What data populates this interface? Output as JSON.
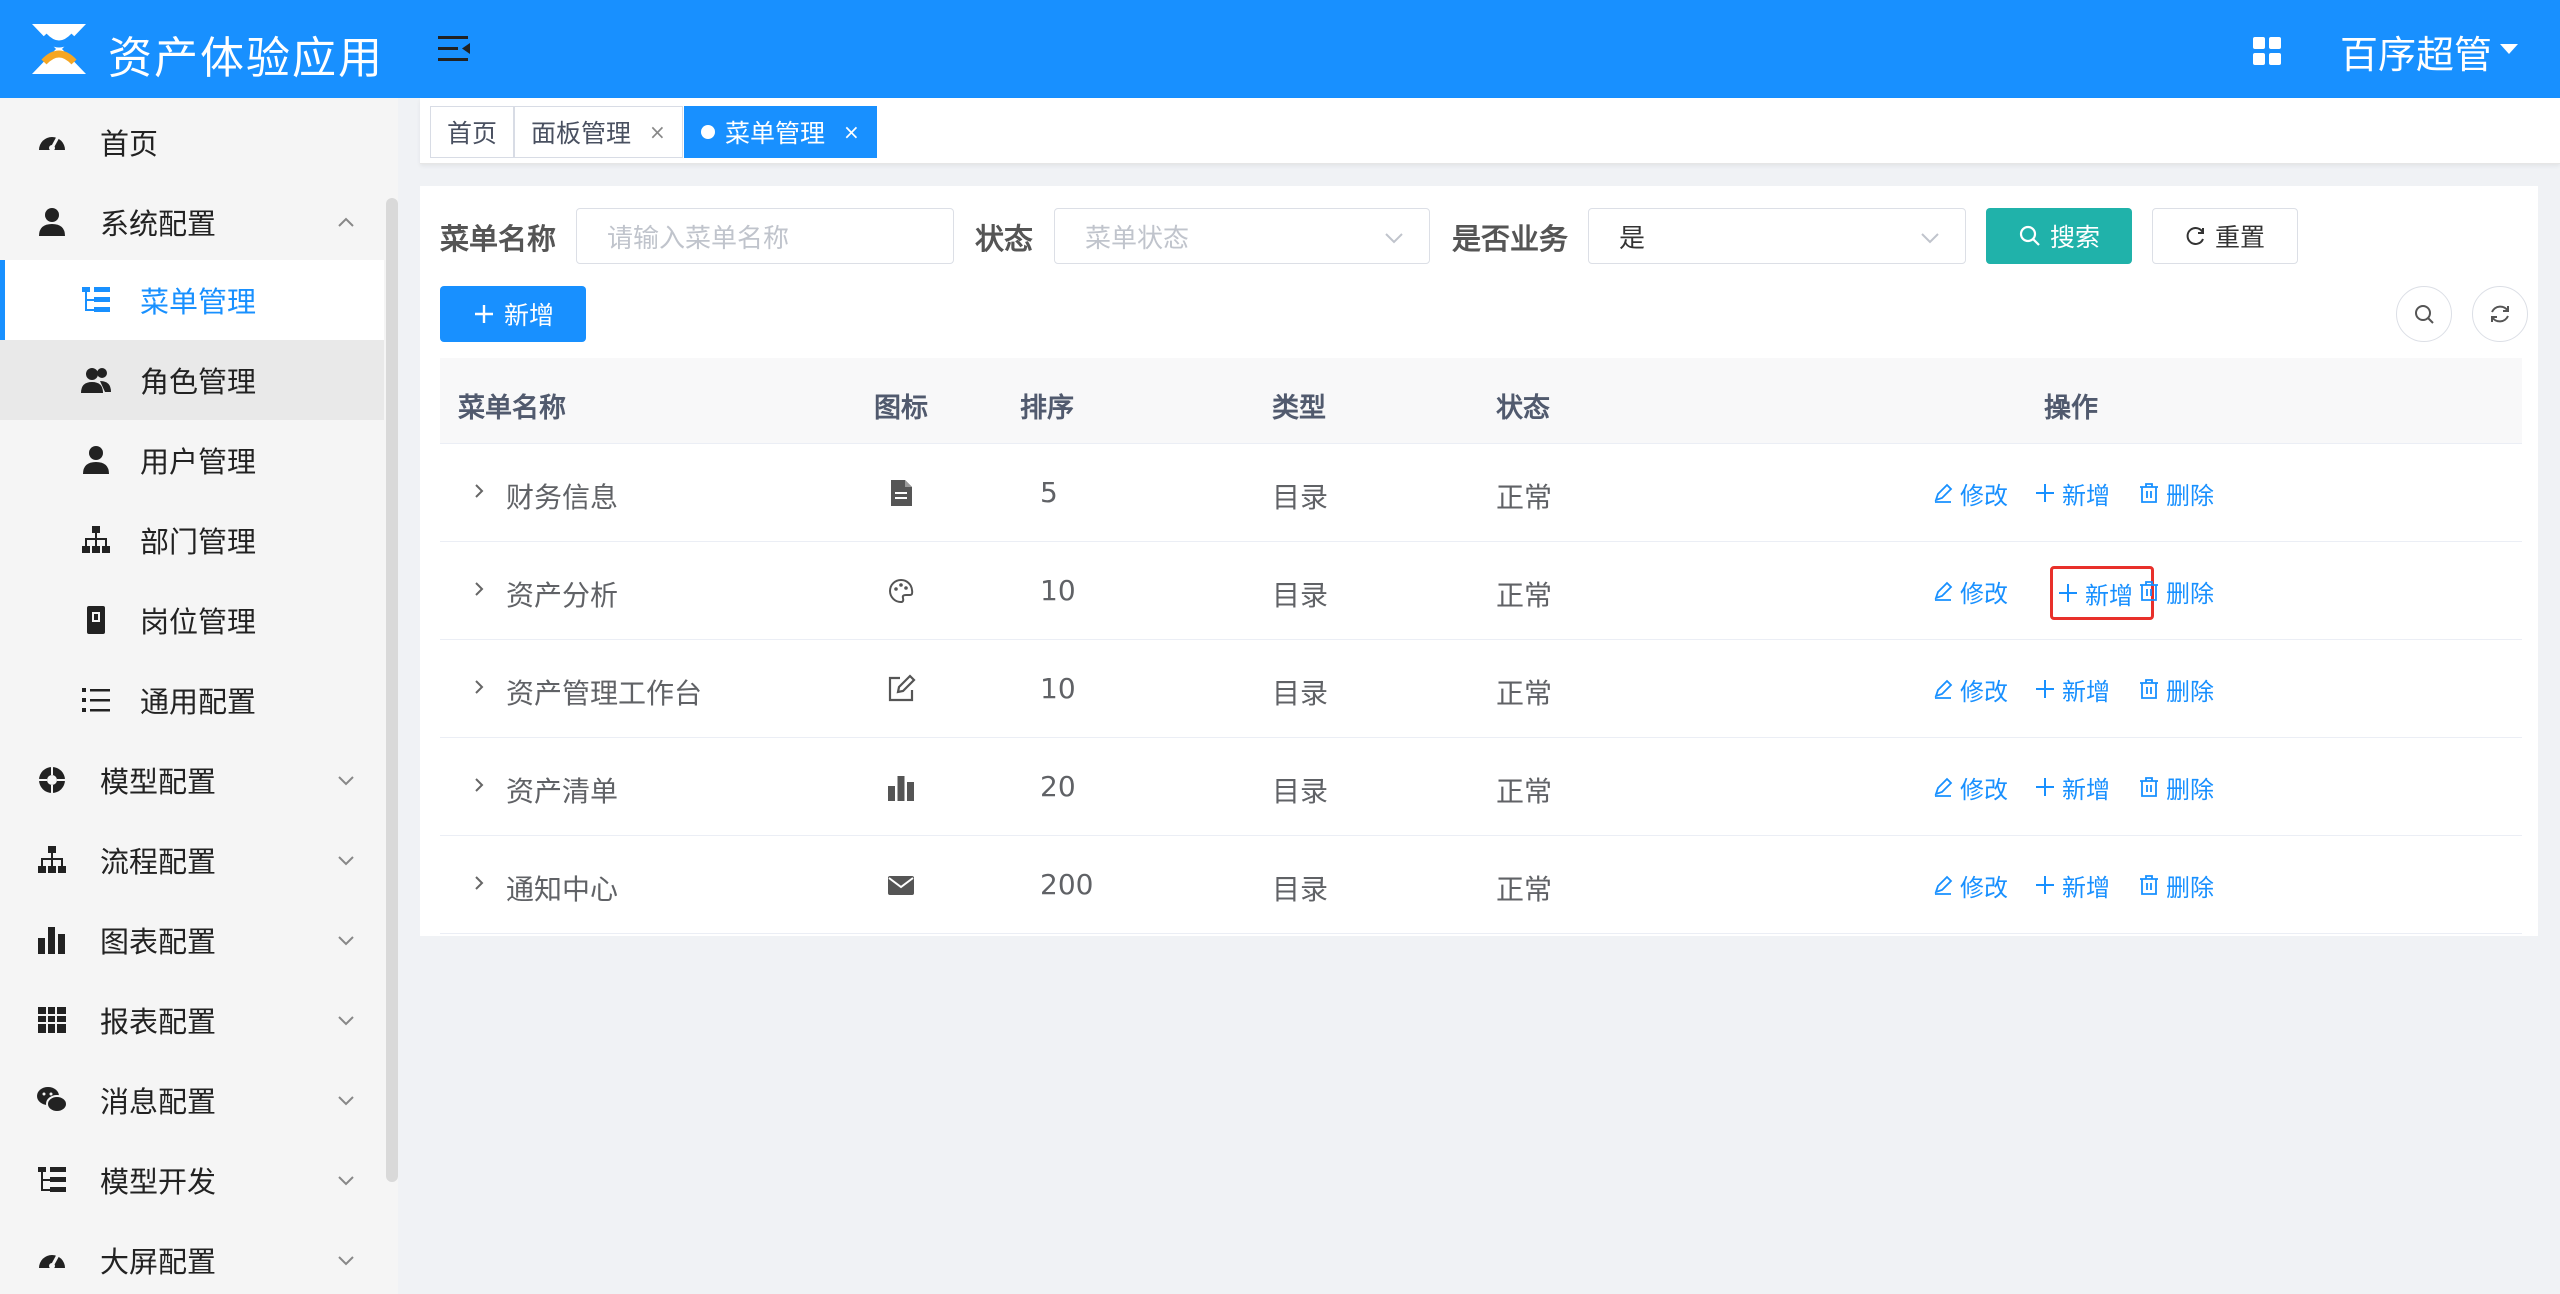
{
  "header": {
    "app_title": "资产体验应用",
    "user_name": "百序超管",
    "brand_color": "#1890ff"
  },
  "sidebar": {
    "items": [
      {
        "label": "首页",
        "icon": "dashboard-icon"
      },
      {
        "label": "系统配置",
        "icon": "user-icon",
        "expanded": true
      },
      {
        "label": "菜单管理",
        "icon": "tree-table-icon",
        "active": true
      },
      {
        "label": "角色管理",
        "icon": "peoples-icon"
      },
      {
        "label": "用户管理",
        "icon": "user-icon"
      },
      {
        "label": "部门管理",
        "icon": "tree-icon"
      },
      {
        "label": "岗位管理",
        "icon": "post-icon"
      },
      {
        "label": "通用配置",
        "icon": "list-icon"
      },
      {
        "label": "模型配置",
        "icon": "model-icon"
      },
      {
        "label": "流程配置",
        "icon": "tree-icon"
      },
      {
        "label": "图表配置",
        "icon": "chart-icon"
      },
      {
        "label": "报表配置",
        "icon": "table-icon"
      },
      {
        "label": "消息配置",
        "icon": "wechat-icon"
      },
      {
        "label": "模型开发",
        "icon": "tree-table-icon"
      },
      {
        "label": "大屏配置",
        "icon": "dashboard-icon"
      }
    ]
  },
  "tabs": [
    {
      "label": "首页"
    },
    {
      "label": "面板管理",
      "close": "×"
    },
    {
      "label": "菜单管理",
      "close": "×",
      "active": true
    }
  ],
  "filters": {
    "menu_name_label": "菜单名称",
    "menu_name_placeholder": "请输入菜单名称",
    "status_label": "状态",
    "status_placeholder": "菜单状态",
    "business_label": "是否业务",
    "business_value": "是",
    "search_btn": "搜索",
    "reset_btn": "重置"
  },
  "toolbar": {
    "add_btn": "新增"
  },
  "table": {
    "columns": [
      "菜单名称",
      "图标",
      "排序",
      "类型",
      "状态",
      "操作"
    ],
    "rows": [
      {
        "name": "财务信息",
        "icon": "document-icon",
        "order": "5",
        "type": "目录",
        "status": "正常"
      },
      {
        "name": "资产分析",
        "icon": "palette-icon",
        "order": "10",
        "type": "目录",
        "status": "正常"
      },
      {
        "name": "资产管理工作台",
        "icon": "edit-icon",
        "order": "10",
        "type": "目录",
        "status": "正常"
      },
      {
        "name": "资产清单",
        "icon": "bar-chart-icon",
        "order": "20",
        "type": "目录",
        "status": "正常"
      },
      {
        "name": "通知中心",
        "icon": "email-icon",
        "order": "200",
        "type": "目录",
        "status": "正常"
      }
    ],
    "ops": {
      "edit": "修改",
      "add": "新增",
      "delete": "删除"
    }
  }
}
